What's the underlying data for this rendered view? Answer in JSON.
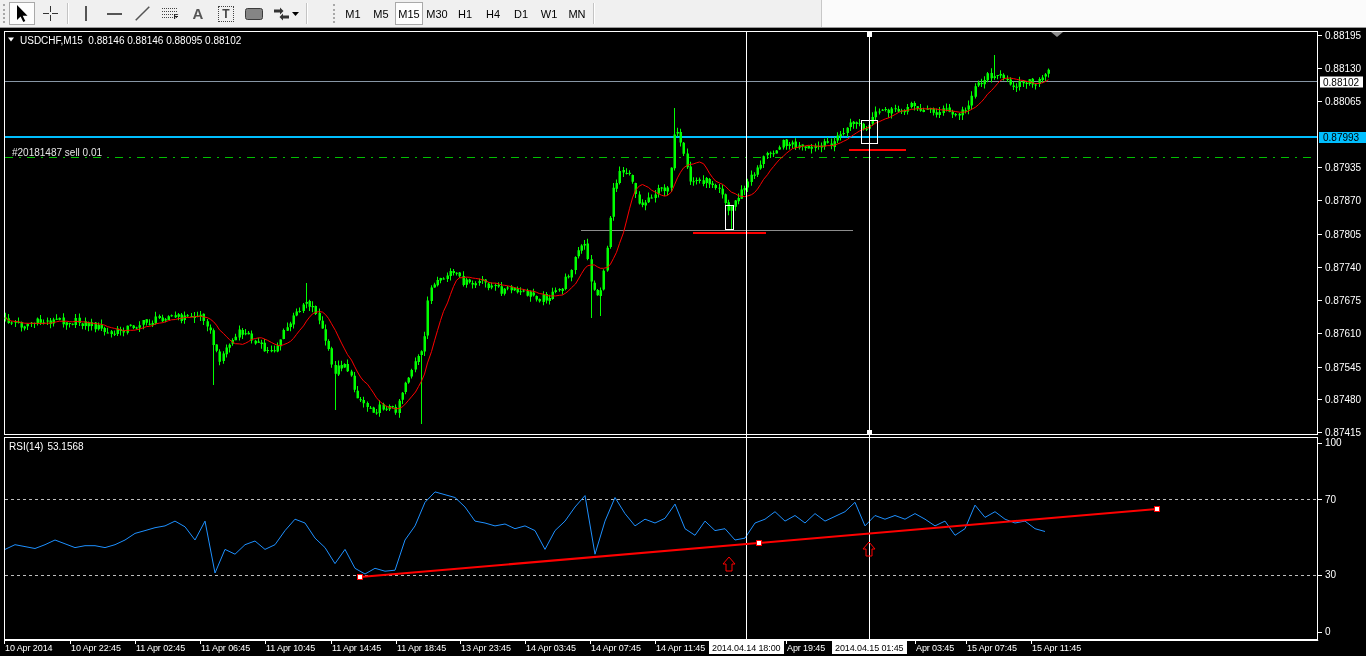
{
  "toolbar": {
    "tools": [
      {
        "kind": "cursor",
        "selected": true
      },
      {
        "kind": "crosshair",
        "selected": false
      },
      {
        "kind": "vertical-line",
        "selected": false
      },
      {
        "kind": "horizontal-line",
        "selected": false
      },
      {
        "kind": "trendline",
        "selected": false
      },
      {
        "kind": "fibonacci",
        "label": "F",
        "selected": false
      },
      {
        "kind": "text",
        "label": "A",
        "selected": false
      },
      {
        "kind": "text-label",
        "label": "T",
        "selected": false
      },
      {
        "kind": "rectangle",
        "selected": false
      },
      {
        "kind": "arrows",
        "selected": false
      }
    ],
    "timeframes": [
      {
        "label": "M1",
        "selected": false
      },
      {
        "label": "M5",
        "selected": false
      },
      {
        "label": "M15",
        "selected": true
      },
      {
        "label": "M30",
        "selected": false
      },
      {
        "label": "H1",
        "selected": false
      },
      {
        "label": "H4",
        "selected": false
      },
      {
        "label": "D1",
        "selected": false
      },
      {
        "label": "W1",
        "selected": false
      },
      {
        "label": "MN",
        "selected": false
      }
    ]
  },
  "price_chart": {
    "title": "USDCHF,M15  0.88146 0.88146 0.88095 0.88102",
    "order_label": "#20181487 sell 0.01",
    "price_axis": [
      {
        "kind": "tick",
        "label": "0.88195"
      },
      {
        "kind": "tick",
        "label": "0.88130"
      },
      {
        "kind": "bid",
        "label": "0.88102"
      },
      {
        "kind": "tick",
        "label": "0.88065"
      },
      {
        "kind": "line",
        "label": "0.87993"
      },
      {
        "kind": "tick",
        "label": "0.87935"
      },
      {
        "kind": "tick",
        "label": "0.87870"
      },
      {
        "kind": "tick",
        "label": "0.87805"
      },
      {
        "kind": "tick",
        "label": "0.87740"
      },
      {
        "kind": "tick",
        "label": "0.87675"
      },
      {
        "kind": "tick",
        "label": "0.87610"
      },
      {
        "kind": "tick",
        "label": "0.87545"
      },
      {
        "kind": "tick",
        "label": "0.87480"
      },
      {
        "kind": "tick",
        "label": "0.87415"
      }
    ]
  },
  "rsi": {
    "value": "53.1568",
    "chart_data": {
      "type": "line",
      "ylim": [
        -4.2,
        102.8
      ],
      "yticks": [
        0,
        30,
        70,
        100
      ],
      "series": [
        {
          "name": "RSI(14)",
          "color": "#1e90ff",
          "values": [
            43.5,
            46,
            45,
            44,
            46,
            48.5,
            46.5,
            44.5,
            45.5,
            45.5,
            44.5,
            46,
            48.5,
            52,
            53.5,
            55,
            56,
            58.5,
            55.5,
            48.5,
            58.5,
            31,
            43.5,
            41,
            46,
            48,
            43.5,
            46,
            53.5,
            59.5,
            57.5,
            49.5,
            44.5,
            36,
            43.5,
            33.5,
            30.5,
            33.5,
            32,
            32.5,
            48.5,
            56,
            68.5,
            74,
            72.5,
            71,
            66,
            58.5,
            57.5,
            56,
            57,
            54.5,
            56,
            53.5,
            43.5,
            53.5,
            58.5,
            66,
            72,
            41,
            58.5,
            71,
            62.5,
            56,
            59.5,
            57.5,
            60,
            67.5,
            54.5,
            51,
            58.5,
            53.5,
            54.5,
            48.5,
            49.5,
            57.5,
            59.5,
            63.5,
            58.5,
            61.5,
            57.5,
            62.5,
            58.5,
            61,
            63.5,
            68.5,
            56,
            61.5,
            59.5,
            61.5,
            59.5,
            62.5,
            59.5,
            56,
            58.5,
            51,
            54.5,
            67,
            60.5,
            63.5,
            59.5,
            57.5,
            58.5,
            54.5,
            53
          ]
        }
      ]
    }
  },
  "time_axis": [
    {
      "kind": "tick",
      "label": "10 Apr 2014"
    },
    {
      "kind": "tick",
      "label": "10 Apr 22:45"
    },
    {
      "kind": "tick",
      "label": "11 Apr 02:45"
    },
    {
      "kind": "tick",
      "label": "11 Apr 06:45"
    },
    {
      "kind": "tick",
      "label": "11 Apr 10:45"
    },
    {
      "kind": "tick",
      "label": "11 Apr 14:45"
    },
    {
      "kind": "tick",
      "label": "11 Apr 18:45"
    },
    {
      "kind": "tick",
      "label": "13 Apr 23:45"
    },
    {
      "kind": "tick",
      "label": "14 Apr 03:45"
    },
    {
      "kind": "tick",
      "label": "14 Apr 07:45"
    },
    {
      "kind": "tick",
      "label": "14 Apr 11:45"
    },
    {
      "kind": "marker",
      "label": "2014.04.14 18:00"
    },
    {
      "kind": "tick",
      "label": "Apr 19:45"
    },
    {
      "kind": "marker",
      "label": "2014.04.15 01:45"
    },
    {
      "kind": "tick",
      "label": "Apr 03:45"
    },
    {
      "kind": "tick",
      "label": "15 Apr 07:45"
    },
    {
      "kind": "tick",
      "label": "15 Apr 11:45"
    }
  ]
}
